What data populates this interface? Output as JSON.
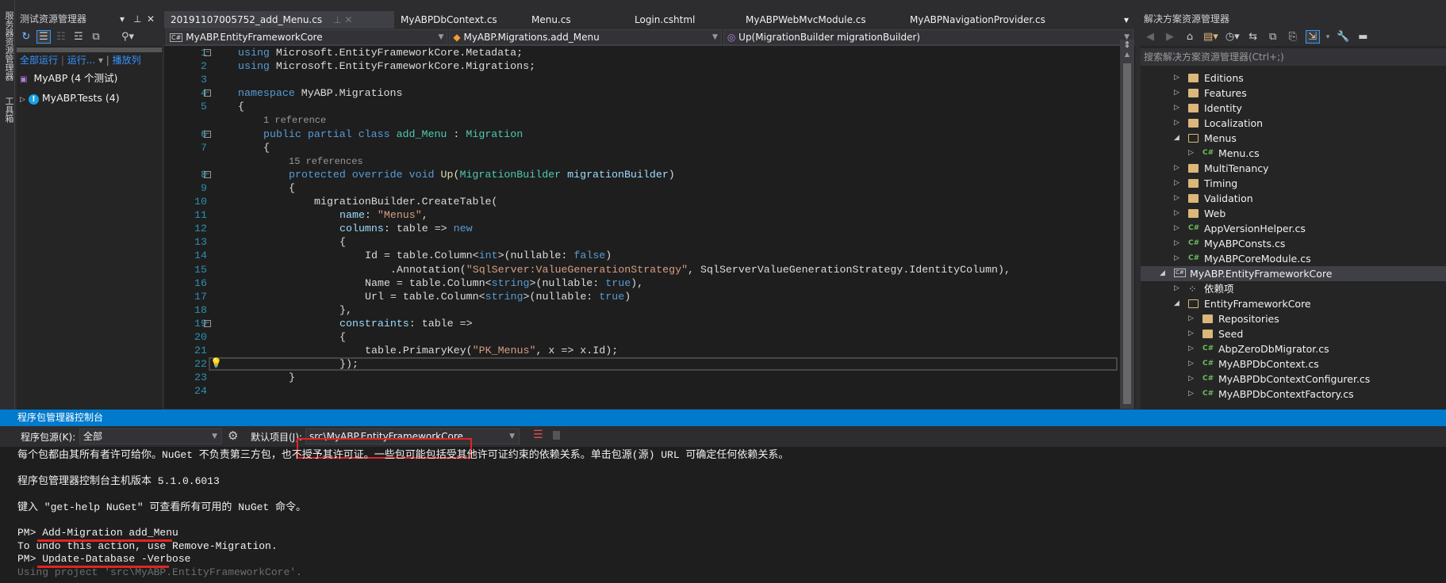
{
  "left_strip": {
    "server_explorer": "服务器资源管理器",
    "toolbox": "工具箱"
  },
  "test_explorer": {
    "title": "测试资源管理器",
    "links": {
      "run_all": "全部运行",
      "run": "运行...",
      "playlist": "播放列"
    },
    "tree": [
      {
        "label": "MyABP (4 个测试)",
        "icon": "test-project-icon"
      },
      {
        "label": "MyABP.Tests (4)",
        "icon": "info-icon"
      }
    ]
  },
  "editor": {
    "tabs": [
      "20191107005752_add_Menu.cs",
      "MyABPDbContext.cs",
      "Menu.cs",
      "Login.cshtml",
      "MyABPWebMvcModule.cs",
      "MyABPNavigationProvider.cs"
    ],
    "active_tab": 0,
    "nav": {
      "project": "MyABP.EntityFrameworkCore",
      "type": "MyABP.Migrations.add_Menu",
      "member": "Up(MigrationBuilder migrationBuilder)"
    },
    "rows": [
      {
        "n": "1",
        "fold": true,
        "ind": 0,
        "t": [
          [
            "using",
            "kw"
          ],
          [
            " Microsoft.EntityFrameworkCore.Metadata;",
            ""
          ]
        ]
      },
      {
        "n": "2",
        "ind": 0,
        "t": [
          [
            "using",
            "kw"
          ],
          [
            " Microsoft.EntityFrameworkCore.Migrations;",
            ""
          ]
        ]
      },
      {
        "n": "3",
        "ind": 0,
        "t": []
      },
      {
        "n": "4",
        "fold": true,
        "ind": 0,
        "t": [
          [
            "namespace",
            "kw"
          ],
          [
            " MyABP.Migrations",
            ""
          ]
        ]
      },
      {
        "n": "5",
        "ind": 0,
        "t": [
          [
            "{",
            ""
          ]
        ]
      },
      {
        "n": "",
        "ind": 4,
        "t": [
          [
            "1 reference",
            "cl"
          ]
        ]
      },
      {
        "n": "6",
        "fold": true,
        "ind": 4,
        "t": [
          [
            "public partial class",
            "kw"
          ],
          [
            " ",
            ""
          ],
          [
            "add_Menu",
            "ty"
          ],
          [
            " : ",
            ""
          ],
          [
            "Migration",
            "ty"
          ]
        ]
      },
      {
        "n": "7",
        "ind": 4,
        "t": [
          [
            "{",
            ""
          ]
        ]
      },
      {
        "n": "",
        "ind": 8,
        "t": [
          [
            "15 references",
            "cl"
          ]
        ]
      },
      {
        "n": "8",
        "fold": true,
        "ind": 8,
        "t": [
          [
            "protected override void",
            "kw"
          ],
          [
            " ",
            ""
          ],
          [
            "Up",
            "me"
          ],
          [
            "(",
            ""
          ],
          [
            "MigrationBuilder",
            "ty"
          ],
          [
            " ",
            ""
          ],
          [
            "migrationBuilder",
            "pa"
          ],
          [
            ")",
            ""
          ]
        ]
      },
      {
        "n": "9",
        "ind": 8,
        "t": [
          [
            "{",
            ""
          ]
        ]
      },
      {
        "n": "10",
        "ind": 12,
        "t": [
          [
            "migrationBuilder.CreateTable(",
            ""
          ]
        ]
      },
      {
        "n": "11",
        "ind": 16,
        "t": [
          [
            "name",
            "pa"
          ],
          [
            ": ",
            ""
          ],
          [
            "\"Menus\"",
            "st"
          ],
          [
            ",",
            ""
          ]
        ]
      },
      {
        "n": "12",
        "ind": 16,
        "t": [
          [
            "columns",
            "pa"
          ],
          [
            ": table => ",
            ""
          ],
          [
            "new",
            "kw"
          ]
        ]
      },
      {
        "n": "13",
        "ind": 16,
        "t": [
          [
            "{",
            ""
          ]
        ]
      },
      {
        "n": "14",
        "ind": 20,
        "t": [
          [
            "Id = table.Column<",
            ""
          ],
          [
            "int",
            "kw"
          ],
          [
            ">(nullable: ",
            ""
          ],
          [
            "false",
            "kw"
          ],
          [
            ")",
            ""
          ]
        ]
      },
      {
        "n": "15",
        "ind": 24,
        "t": [
          [
            ".Annotation(",
            ""
          ],
          [
            "\"SqlServer:ValueGenerationStrategy\"",
            "st"
          ],
          [
            ", SqlServerValueGenerationStrategy.IdentityColumn),",
            ""
          ]
        ]
      },
      {
        "n": "16",
        "ind": 20,
        "t": [
          [
            "Name = table.Column<",
            ""
          ],
          [
            "string",
            "kw"
          ],
          [
            ">(nullable: ",
            ""
          ],
          [
            "true",
            "kw"
          ],
          [
            "),",
            ""
          ]
        ]
      },
      {
        "n": "17",
        "ind": 20,
        "t": [
          [
            "Url = table.Column<",
            ""
          ],
          [
            "string",
            "kw"
          ],
          [
            ">(nullable: ",
            ""
          ],
          [
            "true",
            "kw"
          ],
          [
            ")",
            ""
          ]
        ]
      },
      {
        "n": "18",
        "ind": 16,
        "t": [
          [
            "},",
            ""
          ]
        ]
      },
      {
        "n": "19",
        "fold": true,
        "ind": 16,
        "t": [
          [
            "constraints",
            "pa"
          ],
          [
            ": table =>",
            ""
          ]
        ]
      },
      {
        "n": "20",
        "ind": 16,
        "t": [
          [
            "{",
            ""
          ]
        ]
      },
      {
        "n": "21",
        "ind": 20,
        "t": [
          [
            "table.PrimaryKey(",
            ""
          ],
          [
            "\"PK_Menus\"",
            "st"
          ],
          [
            ", x => x.Id);",
            ""
          ]
        ]
      },
      {
        "n": "22",
        "ind": 16,
        "cur": true,
        "bulb": true,
        "t": [
          [
            "});",
            ""
          ]
        ]
      },
      {
        "n": "23",
        "ind": 8,
        "t": [
          [
            "}",
            ""
          ]
        ]
      },
      {
        "n": "24",
        "ind": 0,
        "t": []
      }
    ]
  },
  "solution_explorer": {
    "title": "解决方案资源管理器",
    "search_placeholder": "搜索解决方案资源管理器(Ctrl+;)",
    "items": [
      {
        "label": "Editions",
        "type": "folder",
        "level": 2,
        "exp": "closed"
      },
      {
        "label": "Features",
        "type": "folder",
        "level": 2,
        "exp": "closed"
      },
      {
        "label": "Identity",
        "type": "folder",
        "level": 2,
        "exp": "closed"
      },
      {
        "label": "Localization",
        "type": "folder",
        "level": 2,
        "exp": "closed"
      },
      {
        "label": "Menus",
        "type": "folder-open",
        "level": 2,
        "exp": "open"
      },
      {
        "label": "Menu.cs",
        "type": "cs",
        "level": 3,
        "exp": "closed"
      },
      {
        "label": "MultiTenancy",
        "type": "folder",
        "level": 2,
        "exp": "closed"
      },
      {
        "label": "Timing",
        "type": "folder",
        "level": 2,
        "exp": "closed"
      },
      {
        "label": "Validation",
        "type": "folder",
        "level": 2,
        "exp": "closed"
      },
      {
        "label": "Web",
        "type": "folder",
        "level": 2,
        "exp": "closed"
      },
      {
        "label": "AppVersionHelper.cs",
        "type": "cs",
        "level": 2,
        "exp": "closed"
      },
      {
        "label": "MyABPConsts.cs",
        "type": "cs",
        "level": 2,
        "exp": "closed"
      },
      {
        "label": "MyABPCoreModule.cs",
        "type": "cs",
        "level": 2,
        "exp": "closed"
      },
      {
        "label": "MyABP.EntityFrameworkCore",
        "type": "project",
        "level": 1,
        "exp": "open",
        "selected": true
      },
      {
        "label": "依赖项",
        "type": "deps",
        "level": 2,
        "exp": "closed"
      },
      {
        "label": "EntityFrameworkCore",
        "type": "folder-open",
        "level": 2,
        "exp": "open"
      },
      {
        "label": "Repositories",
        "type": "folder",
        "level": 3,
        "exp": "closed"
      },
      {
        "label": "Seed",
        "type": "folder",
        "level": 3,
        "exp": "closed"
      },
      {
        "label": "AbpZeroDbMigrator.cs",
        "type": "cs",
        "level": 3,
        "exp": "closed"
      },
      {
        "label": "MyABPDbContext.cs",
        "type": "cs",
        "level": 3,
        "exp": "closed"
      },
      {
        "label": "MyABPDbContextConfigurer.cs",
        "type": "cs",
        "level": 3,
        "exp": "closed"
      },
      {
        "label": "MyABPDbContextFactory.cs",
        "type": "cs",
        "level": 3,
        "exp": "closed"
      }
    ]
  },
  "package_manager_console": {
    "title": "程序包管理器控制台",
    "source_label": "程序包源(K):",
    "source_value": "全部",
    "default_project_label": "默认项目(J):",
    "default_project_value": "src\\MyABP.EntityFrameworkCore",
    "lines": [
      {
        "text": "每个包都由其所有者许可给你。NuGet 不负责第三方包，也不授予其许可证。一些包可能包括受其他许可证约束的依赖关系。单击包源(源) URL 可确定任何依赖关系。"
      },
      {
        "text": ""
      },
      {
        "text": "程序包管理器控制台主机版本 5.1.0.6013"
      },
      {
        "text": ""
      },
      {
        "text": "键入 \"get-help NuGet\" 可查看所有可用的 NuGet 命令。"
      },
      {
        "text": ""
      },
      {
        "text": "PM> Add-Migration add_Menu"
      },
      {
        "text": "To undo this action, use Remove-Migration."
      },
      {
        "text": "PM> Update-Database -Verbose"
      },
      {
        "text": "Using project 'src\\MyABP.EntityFrameworkCore'.",
        "dim": true
      }
    ]
  },
  "colors": {
    "accent": "#007acc",
    "annotation_red": "#e52323",
    "keyword": "#569cd6",
    "type": "#4ec9b0",
    "string": "#d69d85"
  }
}
